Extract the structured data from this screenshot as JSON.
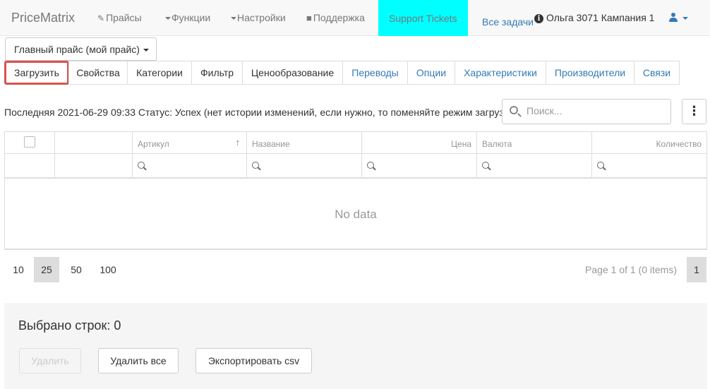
{
  "navbar": {
    "brand": "PriceMatrix",
    "prices": "Прайсы",
    "functions": "Функции",
    "settings": "Настройки",
    "support": "Поддержка",
    "support_tickets": "Support Tickets",
    "all_tasks": "Все задачи",
    "user_info": "Ольга 3071 Кампания 1",
    "accent_color": "#00ffff",
    "link_color": "#337ab7"
  },
  "price_selector": {
    "label": "Главный прайс (мой прайс)"
  },
  "tabs": [
    {
      "label": "Загрузить"
    },
    {
      "label": "Свойства"
    },
    {
      "label": "Категории"
    },
    {
      "label": "Фильтр"
    },
    {
      "label": "Ценообразование"
    },
    {
      "label": "Переводы"
    },
    {
      "label": "Опции"
    },
    {
      "label": "Характеристики"
    },
    {
      "label": "Производители"
    },
    {
      "label": "Связи"
    }
  ],
  "status_line": "Последняя 2021-06-29 09:33 Статус: Успех (нет истории изменений, если нужно, то поменяйте режим загрузки)",
  "search": {
    "placeholder": "Поиск..."
  },
  "grid": {
    "columns": [
      "Артикул",
      "Название",
      "Цена",
      "Валюта",
      "Количество"
    ],
    "empty_text": "No data"
  },
  "pager": {
    "page_sizes": [
      "10",
      "25",
      "50",
      "100"
    ],
    "selected_page_size": "25",
    "info": "Page 1 of 1 (0 items)",
    "current_page": "1"
  },
  "selection": {
    "label": "Выбрано строк: 0",
    "delete_button": "Удалить",
    "delete_all_button": "Удалить все",
    "export_button": "Экспортировать csv"
  }
}
